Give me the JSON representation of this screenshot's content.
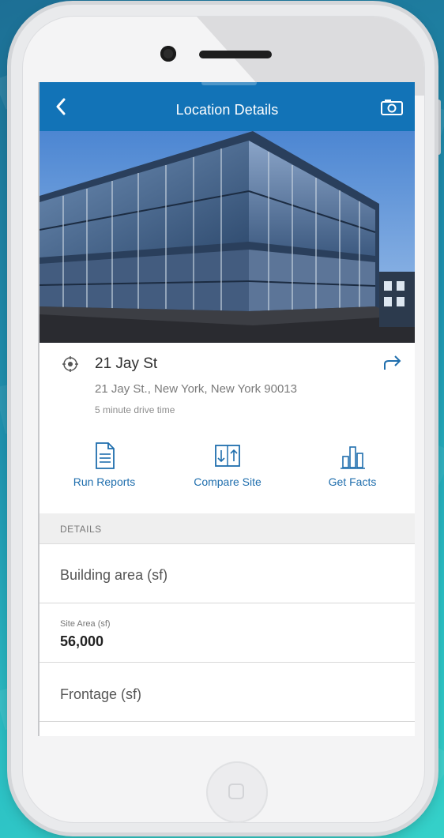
{
  "header": {
    "title": "Location Details",
    "back_icon": "chevron-left-icon",
    "camera_icon": "camera-icon"
  },
  "location": {
    "name": "21 Jay St",
    "address": "21 Jay St., New York, New York 90013",
    "drive_time": "5 minute drive time",
    "pin_icon": "location-marker-icon",
    "share_icon": "share-arrow-icon"
  },
  "actions": [
    {
      "label": "Run Reports",
      "icon": "report-document-icon"
    },
    {
      "label": "Compare Site",
      "icon": "compare-icon"
    },
    {
      "label": "Get Facts",
      "icon": "bar-chart-icon"
    }
  ],
  "details": {
    "section_title": "DETAILS",
    "building_area_label": "Building area (sf)",
    "site_area_label": "Site Area (sf)",
    "site_area_value": "56,000",
    "frontage_label": "Frontage (sf)"
  },
  "colors": {
    "accent": "#1273b7",
    "link": "#1f6ead"
  }
}
